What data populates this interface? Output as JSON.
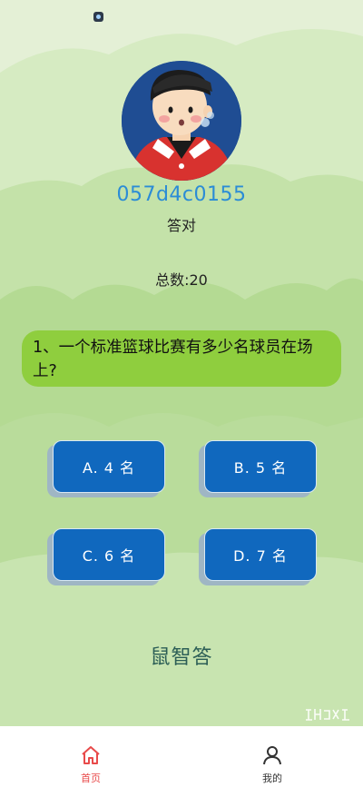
{
  "user": {
    "username": "057d4c0155",
    "status": "答对"
  },
  "quiz": {
    "total_label": "总数:20",
    "question": "1、一个标准篮球比赛有多少名球员在场上?",
    "options": [
      "A. 4 名",
      "B. 5 名",
      "C. 6 名",
      "D. 7 名"
    ]
  },
  "brand": "鼠智答",
  "watermark": "创投派",
  "tabbar": {
    "items": [
      {
        "label": "首页",
        "icon": "home-icon",
        "active": true
      },
      {
        "label": "我的",
        "icon": "person-icon",
        "active": false
      }
    ]
  },
  "colors": {
    "option_bg": "#1068be",
    "question_bg": "#8fce3e",
    "username": "#2b8cd6",
    "tab_active": "#e84a4a",
    "brand": "#2c5e56"
  }
}
